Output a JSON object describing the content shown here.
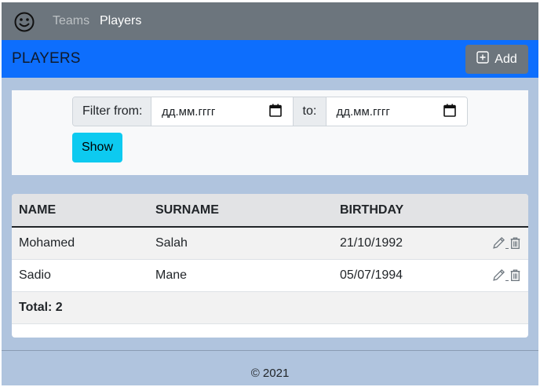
{
  "navbar": {
    "brand_icon": "smiley-icon",
    "links": [
      {
        "label": "Teams",
        "active": false
      },
      {
        "label": "Players",
        "active": true
      }
    ]
  },
  "header": {
    "title": "PLAYERS",
    "add_label": "Add",
    "add_icon": "plus-square-icon"
  },
  "filter": {
    "from_label": "Filter from:",
    "from_value": "дд.мм.гггг",
    "to_label": "to:",
    "to_value": "дд.мм.гггг",
    "show_label": "Show"
  },
  "table": {
    "columns": [
      "NAME",
      "SURNAME",
      "BIRTHDAY"
    ],
    "rows": [
      {
        "name": "Mohamed",
        "surname": "Salah",
        "birthday": "21/10/1992"
      },
      {
        "name": "Sadio",
        "surname": "Mane",
        "birthday": "05/07/1994"
      }
    ],
    "total_label": "Total: 2"
  },
  "footer": {
    "text": "© 2021"
  },
  "colors": {
    "navbar": "#6c757d",
    "header": "#0d6efd",
    "page_bg": "#b0c4de",
    "show_button": "#0dcaf0"
  }
}
